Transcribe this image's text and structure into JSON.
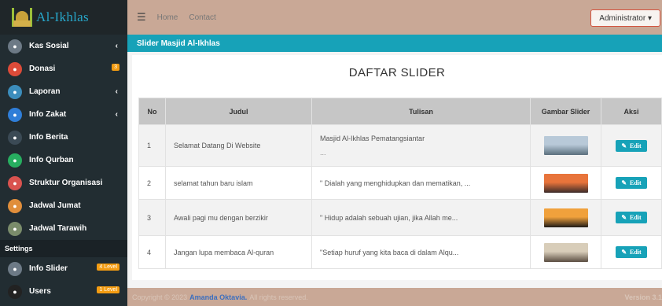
{
  "brand": {
    "name": "Al-Ikhlas"
  },
  "sidebar": {
    "items": [
      {
        "label": "Kas Sosial",
        "icon": "cash-icon",
        "color": "#6d7a86",
        "chevron": "‹"
      },
      {
        "label": "Donasi",
        "icon": "donation-icon",
        "color": "#dd4b39",
        "badge": "3"
      },
      {
        "label": "Laporan",
        "icon": "report-icon",
        "color": "#3c8dbc",
        "chevron": "‹"
      },
      {
        "label": "Info Zakat",
        "icon": "zakat-icon",
        "color": "#2f7ed8",
        "chevron": "‹"
      },
      {
        "label": "Info Berita",
        "icon": "news-icon",
        "color": "#3b4a55"
      },
      {
        "label": "Info Qurban",
        "icon": "qurban-icon",
        "color": "#27ae60"
      },
      {
        "label": "Struktur Organisasi",
        "icon": "organization-icon",
        "color": "#d9534f"
      },
      {
        "label": "Jadwal Jumat",
        "icon": "friday-schedule-icon",
        "color": "#e08e3b"
      },
      {
        "label": "Jadwal Tarawih",
        "icon": "tarawih-schedule-icon",
        "color": "#7a8c6b"
      }
    ],
    "settings_header": "Settings",
    "settings_items": [
      {
        "label": "Info Slider",
        "icon": "slider-icon",
        "color": "#6d7a86",
        "badge": "4 Level"
      },
      {
        "label": "Users",
        "icon": "users-icon",
        "color": "#222",
        "badge": "1 Level"
      }
    ]
  },
  "topbar": {
    "home": "Home",
    "contact": "Contact",
    "user_menu": "Administrator ▾"
  },
  "page": {
    "bar_title": "Slider Masjid Al-Ikhlas",
    "card_title": "DAFTAR SLIDER"
  },
  "table": {
    "headers": [
      "No",
      "Judul",
      "Tulisan",
      "Gambar Slider",
      "Aksi"
    ],
    "rows": [
      {
        "no": "1",
        "judul": "Selamat Datang Di Website",
        "tulisan": "Masjid Al-Ikhlas Pematangsiantar",
        "extra": "...",
        "img_colors": [
          "#b8c9d8",
          "#5a6f7d"
        ],
        "action": "Edit"
      },
      {
        "no": "2",
        "judul": "selamat tahun baru islam",
        "tulisan": "\" Dialah yang menghidupkan dan mematikan, ...",
        "extra": "",
        "img_colors": [
          "#e8743b",
          "#3a2b2a"
        ],
        "action": "Edit"
      },
      {
        "no": "3",
        "judul": "Awali pagi mu dengan berzikir",
        "tulisan": "\" Hidup adalah sebuah ujian, jika Allah me...",
        "extra": "",
        "img_colors": [
          "#f0a13c",
          "#1e1a17"
        ],
        "action": "Edit"
      },
      {
        "no": "4",
        "judul": "Jangan lupa membaca Al-quran",
        "tulisan": "\"Setiap huruf yang kita baca di dalam Alqu...",
        "extra": "",
        "img_colors": [
          "#d8cdb9",
          "#5b4e42"
        ],
        "action": "Edit"
      }
    ]
  },
  "footer": {
    "prefix": "Copyright © 2023",
    "author": "Amanda Oktavia.",
    "suffix": "All rights reserved.",
    "version": "Version 3.1"
  }
}
